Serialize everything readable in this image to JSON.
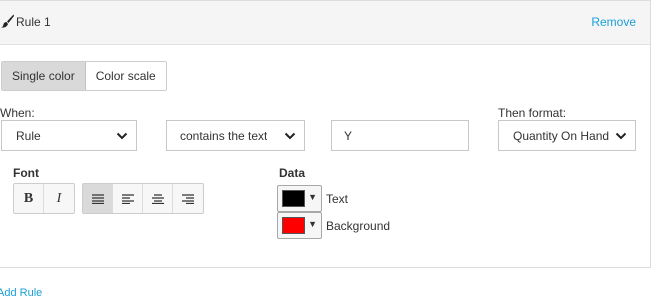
{
  "rule": {
    "title": "Rule 1",
    "remove_label": "Remove",
    "header_icon": "paintbrush-icon"
  },
  "mode_tabs": {
    "items": [
      {
        "label": "Single color",
        "active": true
      },
      {
        "label": "Color scale",
        "active": false
      }
    ]
  },
  "condition": {
    "when_label": "When:",
    "field_value": "Rule",
    "operator_value": "contains the text",
    "text_value": "Y",
    "then_label": "Then format:",
    "target_value": "Quantity On Hand"
  },
  "font": {
    "label": "Font",
    "bold_label": "B",
    "italic_label": "I",
    "align_buttons": [
      "align-justify-icon",
      "align-left-icon",
      "align-center-icon",
      "align-right-icon"
    ],
    "active_align": "align-justify-icon"
  },
  "data": {
    "label": "Data",
    "text_color_label": "Text",
    "text_color": "#000000",
    "background_label": "Background",
    "background_color": "#ff0000"
  },
  "add_rule_label": "Add Rule",
  "colors": {
    "link": "#1a9fd8",
    "header_bg": "#f5f5f5",
    "active_tab_bg": "#d9d9d9"
  }
}
